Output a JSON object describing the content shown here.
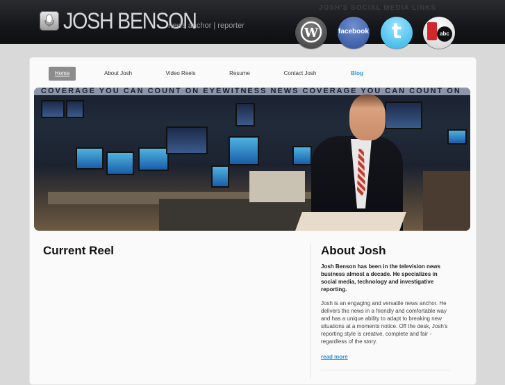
{
  "header": {
    "logo_name": "JOSH BENSON",
    "tagline": "news anchor | reporter",
    "social_title": "JOSH'S SOCIAL MEDIA LINKS",
    "social": [
      {
        "name": "wordpress",
        "label": "W"
      },
      {
        "name": "facebook",
        "label": "facebook"
      },
      {
        "name": "twitter",
        "label": "t"
      },
      {
        "name": "wetv-abc",
        "label": "abc"
      }
    ]
  },
  "nav": {
    "items": [
      "Home",
      "About Josh",
      "Video Reels",
      "Resume",
      "Contact Josh",
      "Blog"
    ]
  },
  "banner": {
    "strip_text": "COVERAGE YOU CAN COUNT ON   EYEWITNESS NEWS   COVERAGE YOU CAN COUNT ON"
  },
  "main": {
    "left_title": "Current Reel",
    "about_title": "About Josh",
    "about_lead": "Josh Benson has been in the television news business almost a decade. He specializes in social media, technology and investigative reporting.",
    "about_body": "Josh is an engaging and versatile news anchor. He delivers the news in a friendly and comfortable way and has a unique ability to adapt to breaking new situations at a moments notice. Off the desk, Josh's reporting style is creative, complete and fair - regardless of the story.",
    "read_more": "read more"
  },
  "colors": {
    "accent": "#2a92d0",
    "header_bg": "#15171a",
    "page_bg": "#d9d9d9",
    "nav_active_bg": "#8c8c8c"
  }
}
